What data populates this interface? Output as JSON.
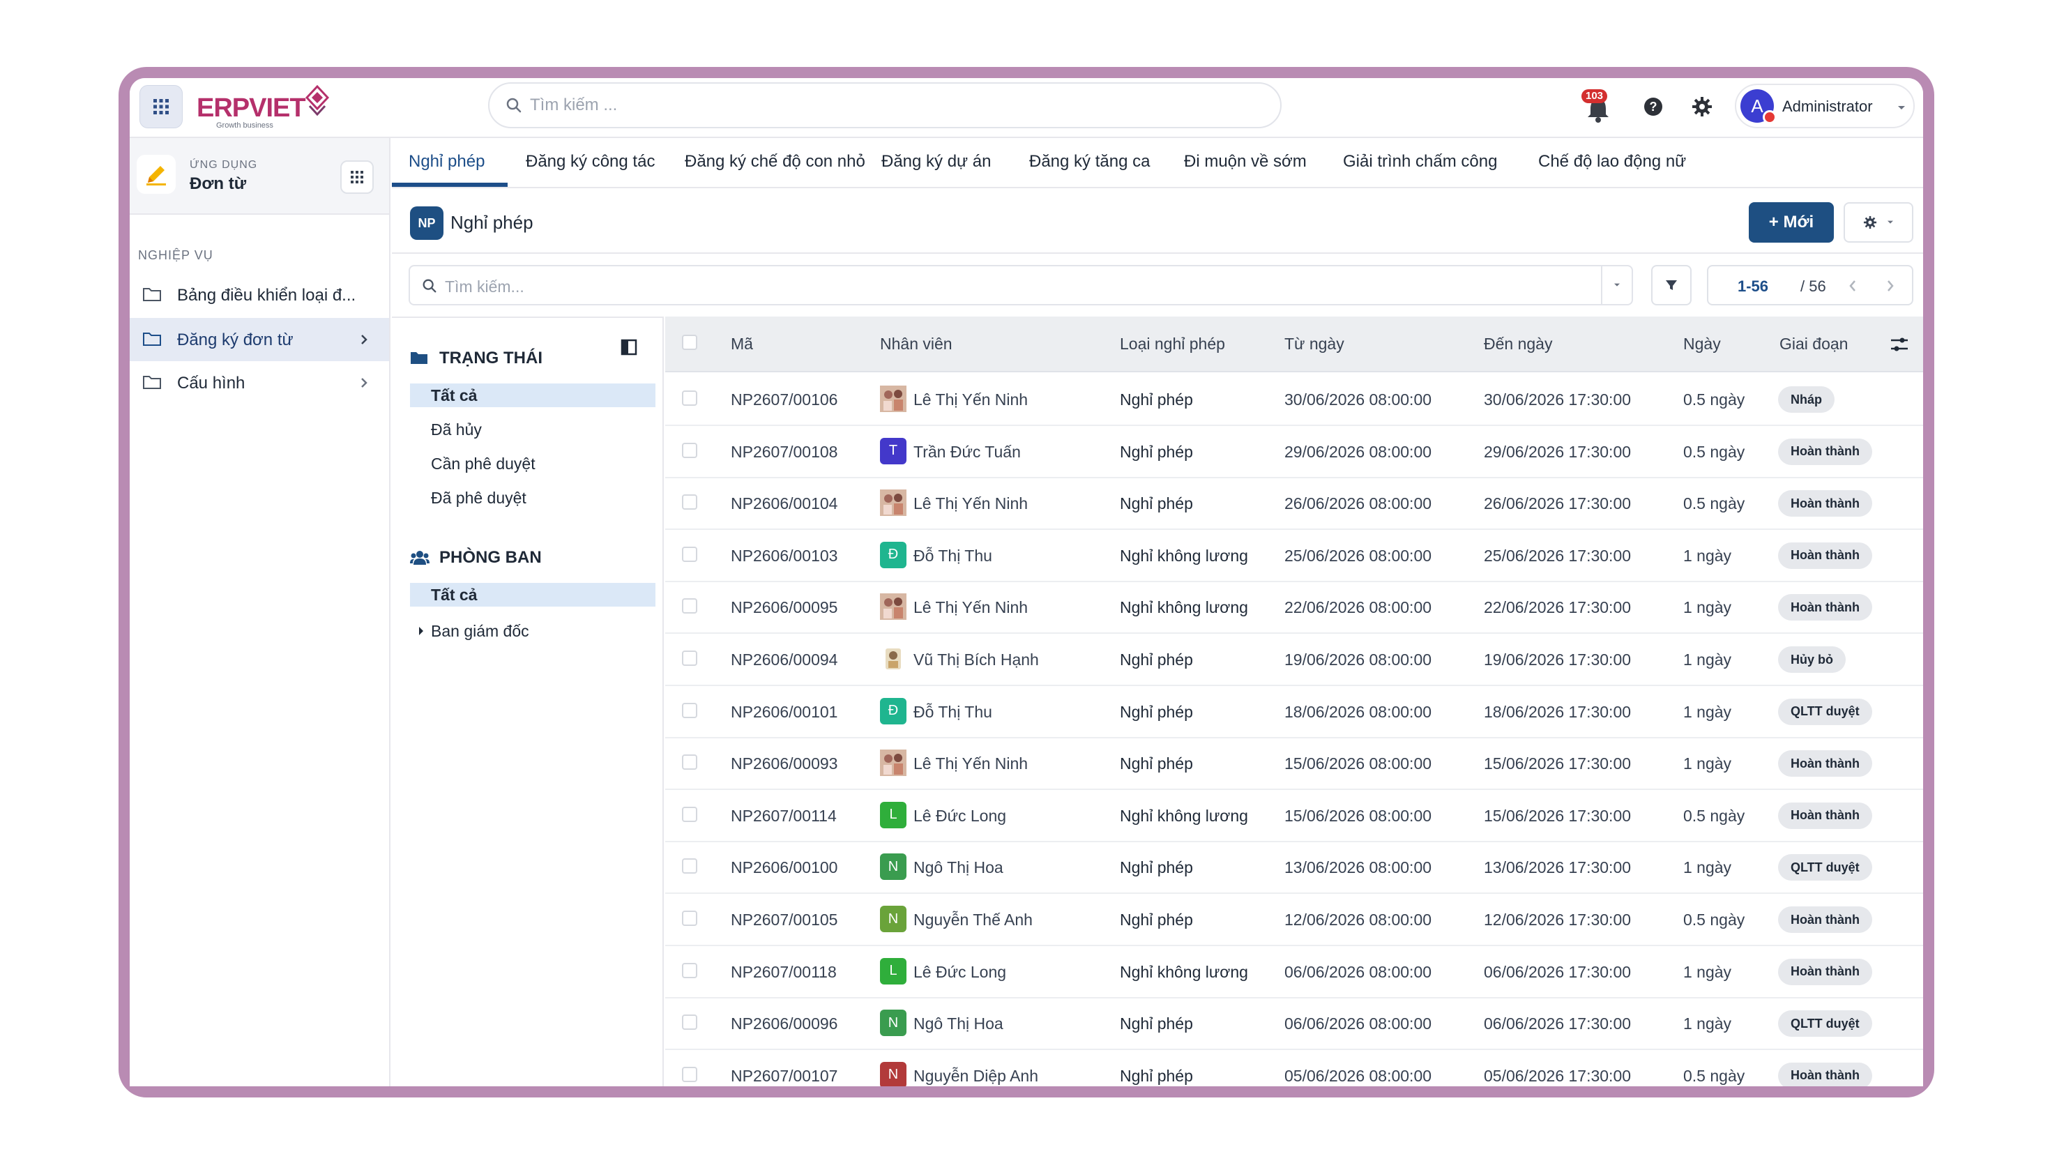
{
  "app": {
    "logo_text": "ERPVIET",
    "logo_tagline": "Growth business",
    "top_search_placeholder": "Tìm kiếm ...",
    "notification_count": "103",
    "user_initial": "A",
    "user_name": "Administrator"
  },
  "sidebar": {
    "app_label": "ỨNG DỤNG",
    "app_name": "Đơn từ",
    "section_label": "NGHIỆP VỤ",
    "items": [
      {
        "label": "Bảng điều khiển loại đ...",
        "chevron": false,
        "active": false
      },
      {
        "label": "Đăng ký đơn từ",
        "chevron": true,
        "active": true
      },
      {
        "label": "Cấu hình",
        "chevron": true,
        "active": false
      }
    ]
  },
  "tabs": [
    {
      "label": "Nghỉ phép",
      "active": true
    },
    {
      "label": "Đăng ký công tác",
      "active": false
    },
    {
      "label": "Đăng ký chế độ con nhỏ",
      "active": false
    },
    {
      "label": "Đăng ký dự án",
      "active": false
    },
    {
      "label": "Đăng ký tăng ca",
      "active": false
    },
    {
      "label": "Đi muộn về sớm",
      "active": false
    },
    {
      "label": "Giải trình chấm công",
      "active": false
    },
    {
      "label": "Chế độ lao động nữ",
      "active": false
    }
  ],
  "page": {
    "badge": "NP",
    "title": "Nghỉ phép",
    "new_button": "+ Mới"
  },
  "list_search": {
    "placeholder": "Tìm kiếm..."
  },
  "pager": {
    "range": "1-56",
    "total": "/ 56"
  },
  "filters": {
    "status_title": "TRẠNG THÁI",
    "status_items": [
      {
        "label": "Tất cả",
        "selected": true
      },
      {
        "label": "Đã hủy",
        "selected": false
      },
      {
        "label": "Cần phê duyệt",
        "selected": false
      },
      {
        "label": "Đã phê duyệt",
        "selected": false
      }
    ],
    "dept_title": "PHÒNG BAN",
    "dept_items": [
      {
        "label": "Tất cả",
        "selected": true
      },
      {
        "label": "Ban giám đốc",
        "selected": false,
        "expandable": true
      }
    ]
  },
  "table": {
    "columns": [
      "Mã",
      "Nhân viên",
      "Loại nghỉ phép",
      "Từ ngày",
      "Đến ngày",
      "Ngày",
      "Giai đoạn"
    ],
    "rows": [
      {
        "code": "NP2607/00106",
        "employee": "Lê Thị Yến Ninh",
        "avatar": "photo",
        "initial": "",
        "avatar_color": "#c9a48b",
        "type": "Nghỉ phép",
        "from": "30/06/2026 08:00:00",
        "to": "30/06/2026 17:30:00",
        "days": "0.5 ngày",
        "stage": "Nháp"
      },
      {
        "code": "NP2607/00108",
        "employee": "Trần Đức Tuấn",
        "avatar": "initial",
        "initial": "T",
        "avatar_color": "#4338ca",
        "type": "Nghỉ phép",
        "from": "29/06/2026 08:00:00",
        "to": "29/06/2026 17:30:00",
        "days": "0.5 ngày",
        "stage": "Hoàn thành"
      },
      {
        "code": "NP2606/00104",
        "employee": "Lê Thị Yến Ninh",
        "avatar": "photo",
        "initial": "",
        "avatar_color": "#c9a48b",
        "type": "Nghỉ phép",
        "from": "26/06/2026 08:00:00",
        "to": "26/06/2026 17:30:00",
        "days": "0.5 ngày",
        "stage": "Hoàn thành"
      },
      {
        "code": "NP2606/00103",
        "employee": "Đỗ Thị Thu",
        "avatar": "initial",
        "initial": "Đ",
        "avatar_color": "#1fb58f",
        "type": "Nghỉ không lương",
        "from": "25/06/2026 08:00:00",
        "to": "25/06/2026 17:30:00",
        "days": "1 ngày",
        "stage": "Hoàn thành"
      },
      {
        "code": "NP2606/00095",
        "employee": "Lê Thị Yến Ninh",
        "avatar": "photo",
        "initial": "",
        "avatar_color": "#c9a48b",
        "type": "Nghỉ không lương",
        "from": "22/06/2026 08:00:00",
        "to": "22/06/2026 17:30:00",
        "days": "1 ngày",
        "stage": "Hoàn thành"
      },
      {
        "code": "NP2606/00094",
        "employee": "Vũ Thị Bích Hạnh",
        "avatar": "photo2",
        "initial": "",
        "avatar_color": "#d9c9a3",
        "type": "Nghỉ phép",
        "from": "19/06/2026 08:00:00",
        "to": "19/06/2026 17:30:00",
        "days": "1 ngày",
        "stage": "Hủy bỏ"
      },
      {
        "code": "NP2606/00101",
        "employee": "Đỗ Thị Thu",
        "avatar": "initial",
        "initial": "Đ",
        "avatar_color": "#1fb58f",
        "type": "Nghỉ phép",
        "from": "18/06/2026 08:00:00",
        "to": "18/06/2026 17:30:00",
        "days": "1 ngày",
        "stage": "QLTT duyệt"
      },
      {
        "code": "NP2606/00093",
        "employee": "Lê Thị Yến Ninh",
        "avatar": "photo",
        "initial": "",
        "avatar_color": "#c9a48b",
        "type": "Nghỉ phép",
        "from": "15/06/2026 08:00:00",
        "to": "15/06/2026 17:30:00",
        "days": "1 ngày",
        "stage": "Hoàn thành"
      },
      {
        "code": "NP2607/00114",
        "employee": "Lê Đức Long",
        "avatar": "initial",
        "initial": "L",
        "avatar_color": "#2fae3b",
        "type": "Nghỉ không lương",
        "from": "15/06/2026 08:00:00",
        "to": "15/06/2026 17:30:00",
        "days": "0.5 ngày",
        "stage": "Hoàn thành"
      },
      {
        "code": "NP2606/00100",
        "employee": "Ngô Thị Hoa",
        "avatar": "initial",
        "initial": "N",
        "avatar_color": "#3a9c4f",
        "type": "Nghỉ phép",
        "from": "13/06/2026 08:00:00",
        "to": "13/06/2026 17:30:00",
        "days": "1 ngày",
        "stage": "QLTT duyệt"
      },
      {
        "code": "NP2607/00105",
        "employee": "Nguyễn Thế Anh",
        "avatar": "initial",
        "initial": "N",
        "avatar_color": "#6aa33a",
        "type": "Nghỉ phép",
        "from": "12/06/2026 08:00:00",
        "to": "12/06/2026 17:30:00",
        "days": "0.5 ngày",
        "stage": "Hoàn thành"
      },
      {
        "code": "NP2607/00118",
        "employee": "Lê Đức Long",
        "avatar": "initial",
        "initial": "L",
        "avatar_color": "#2fae3b",
        "type": "Nghỉ không lương",
        "from": "06/06/2026 08:00:00",
        "to": "06/06/2026 17:30:00",
        "days": "1 ngày",
        "stage": "Hoàn thành"
      },
      {
        "code": "NP2606/00096",
        "employee": "Ngô Thị Hoa",
        "avatar": "initial",
        "initial": "N",
        "avatar_color": "#3a9c4f",
        "type": "Nghỉ phép",
        "from": "06/06/2026 08:00:00",
        "to": "06/06/2026 17:30:00",
        "days": "1 ngày",
        "stage": "QLTT duyệt"
      },
      {
        "code": "NP2607/00107",
        "employee": "Nguyễn Diệp Anh",
        "avatar": "initial",
        "initial": "N",
        "avatar_color": "#b23a3a",
        "type": "Nghỉ phép",
        "from": "05/06/2026 08:00:00",
        "to": "05/06/2026 17:30:00",
        "days": "0.5 ngày",
        "stage": "Hoàn thành"
      }
    ]
  },
  "colors": {
    "frame": "#b98bb3",
    "primary": "#1e4f82",
    "selected_filter": "#dbe8f7",
    "badge_red": "#d32f2f"
  }
}
